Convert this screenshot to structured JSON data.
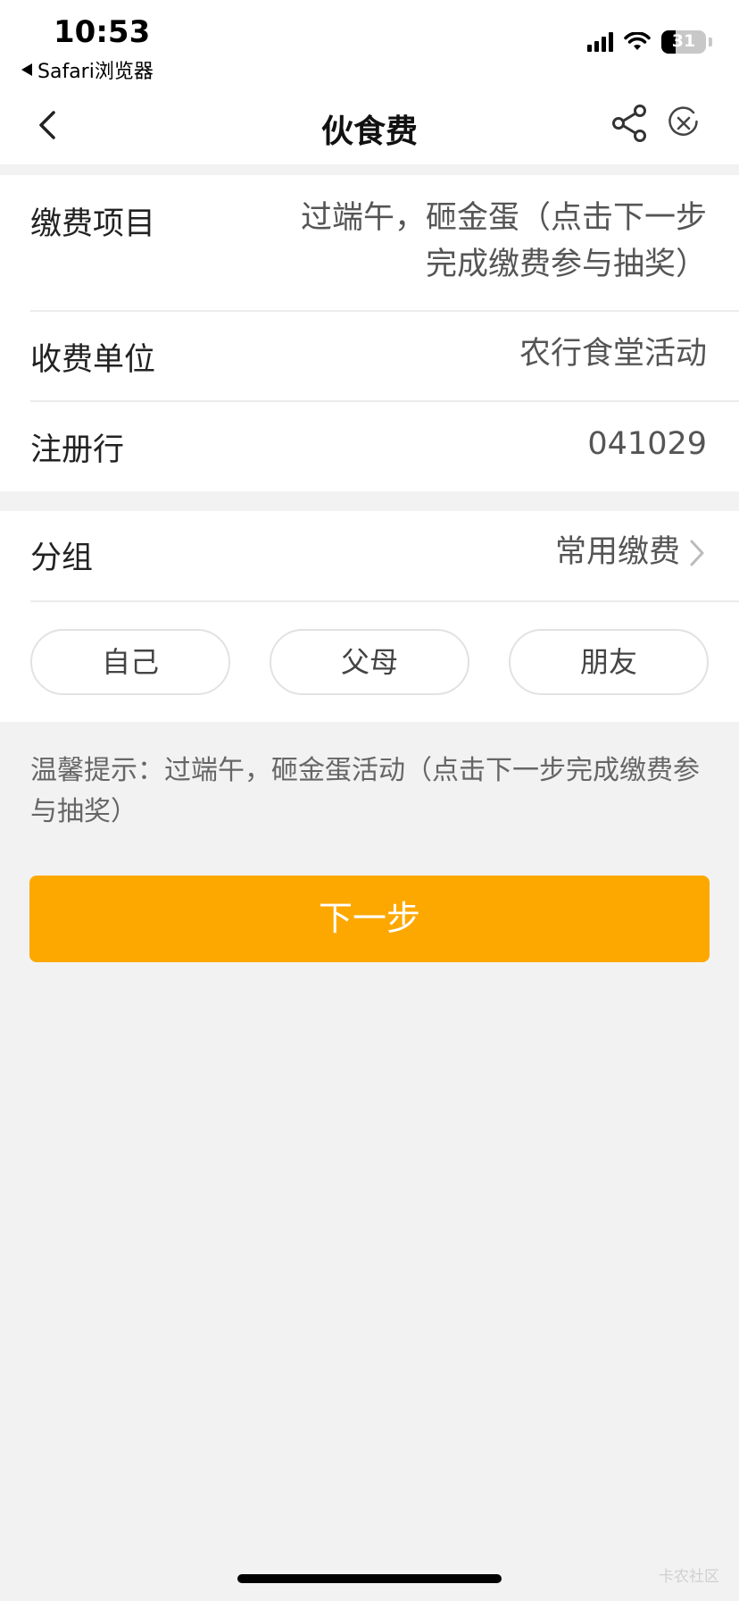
{
  "status": {
    "time": "10:53",
    "back_app": "Safari浏览器",
    "battery": "31"
  },
  "nav": {
    "title": "伙食费"
  },
  "info": {
    "rows": [
      {
        "label": "缴费项目",
        "value_line1": "过端午，砸金蛋（点击下一步",
        "value_line2": "完成缴费参与抽奖）"
      },
      {
        "label": "收费单位",
        "value": "农行食堂活动"
      },
      {
        "label": "注册行",
        "value": "041029"
      }
    ]
  },
  "group": {
    "label": "分组",
    "value": "常用缴费",
    "chips": [
      "自己",
      "父母",
      "朋友"
    ]
  },
  "tip": "温馨提示：过端午，砸金蛋活动（点击下一步完成缴费参与抽奖）",
  "next_button": "下一步",
  "watermark": "卡农社区",
  "colors": {
    "accent": "#fda800",
    "background": "#f2f2f2"
  }
}
